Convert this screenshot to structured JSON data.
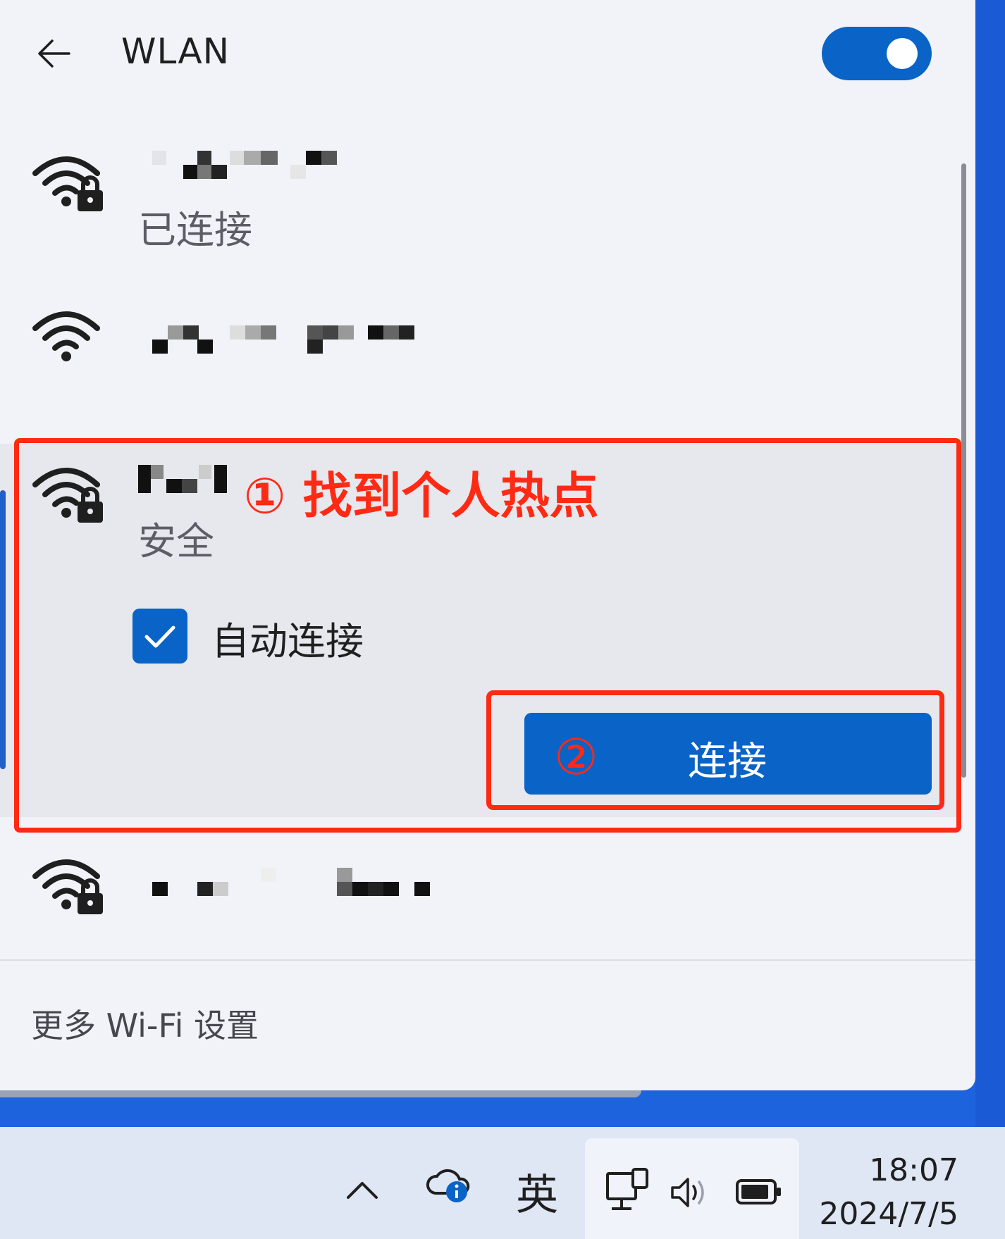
{
  "window": {
    "title": "WLAN",
    "toggle_state": "on"
  },
  "networks": [
    {
      "status": "已连接",
      "secured": true
    },
    {
      "status": "",
      "secured": false
    },
    {
      "status": "安全",
      "secured": true,
      "auto_connect_label": "自动连接",
      "auto_connect_checked": true,
      "connect_label": "连接"
    },
    {
      "status": "",
      "secured": true
    }
  ],
  "annotations": {
    "step1": "① 找到个人热点",
    "step2": "②"
  },
  "footer": {
    "more_settings": "更多 Wi-Fi 设置"
  },
  "taskbar": {
    "ime": "英",
    "time": "18:07",
    "date": "2024/7/5"
  },
  "colors": {
    "accent": "#0a63c6",
    "annotation": "#ff2a14",
    "desktop": "#1b5fd8"
  }
}
